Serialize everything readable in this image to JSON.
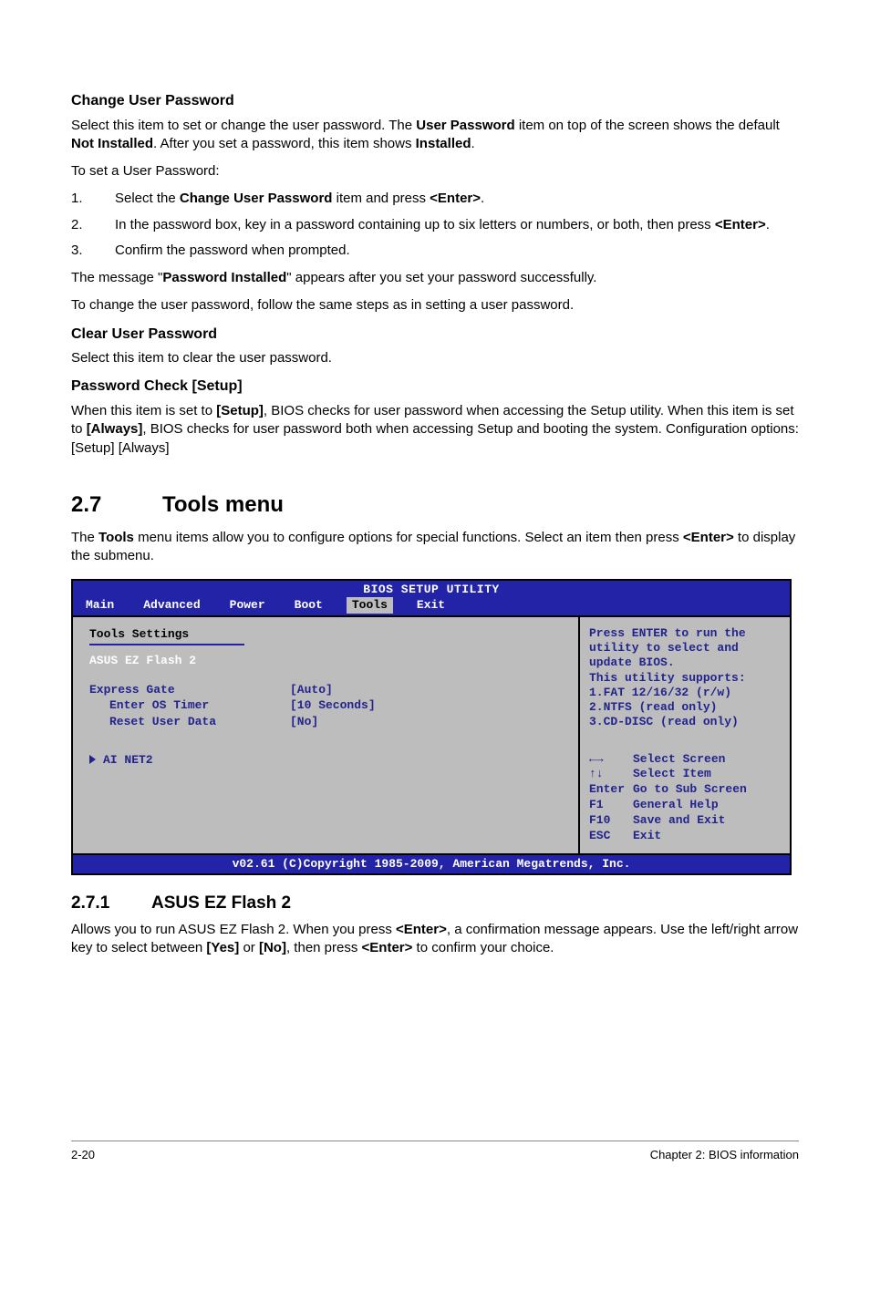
{
  "sec_change_user_pw": {
    "heading": "Change User Password",
    "p1_a": "Select this item to set or change the user password. The ",
    "p1_b": "User Password",
    "p1_c": " item on top of the screen shows the default ",
    "p1_d": "Not Installed",
    "p1_e": ". After you set a password, this item shows ",
    "p1_f": "Installed",
    "p1_g": ".",
    "p2": "To set a User Password:",
    "steps": [
      {
        "n": "1.",
        "t_a": "Select the ",
        "t_b": "Change User Password",
        "t_c": " item and press ",
        "t_d": "<Enter>",
        "t_e": "."
      },
      {
        "n": "2.",
        "t_a": "In the password box, key in a password containing up to six letters or numbers, or both, then press ",
        "t_b": "<Enter>",
        "t_c": "."
      },
      {
        "n": "3.",
        "t_a": "Confirm the password when prompted."
      }
    ],
    "p3_a": "The message \"",
    "p3_b": "Password Installed",
    "p3_c": "\" appears after you set your password successfully.",
    "p4": "To change the user password, follow the same steps as in setting a user password."
  },
  "sec_clear_user_pw": {
    "heading": "Clear User Password",
    "p1": "Select this item to clear the user password."
  },
  "sec_pw_check": {
    "heading": "Password Check [Setup]",
    "p1_a": "When this item is set to ",
    "p1_b": "[Setup]",
    "p1_c": ", BIOS checks for user password when accessing the Setup utility. When this item is set to ",
    "p1_d": "[Always]",
    "p1_e": ", BIOS checks for user password both when accessing Setup and booting the system. Configuration options: [Setup] [Always]"
  },
  "sec_tools": {
    "num": "2.7",
    "title": "Tools menu",
    "p1_a": "The ",
    "p1_b": "Tools",
    "p1_c": " menu items allow you to configure options for special functions. Select an item then press ",
    "p1_d": "<Enter>",
    "p1_e": " to display the submenu."
  },
  "bios": {
    "title": "BIOS SETUP UTILITY",
    "tabs": [
      "Main",
      "Advanced",
      "Power",
      "Boot",
      "Tools",
      "Exit"
    ],
    "tools_title": "Tools Settings",
    "item_ezflash": "ASUS EZ Flash 2",
    "rows": [
      {
        "label": "Express Gate",
        "val": "[Auto]"
      },
      {
        "label": "Enter OS Timer",
        "val": "[10 Seconds]"
      },
      {
        "label": "Reset User Data",
        "val": "[No]"
      }
    ],
    "item_ainet": "AI NET2",
    "help": "Press ENTER to run the utility to select and update BIOS.\nThis utility supports:\n1.FAT 12/16/32 (r/w)\n2.NTFS (read only)\n3.CD-DISC (read only)",
    "keys": [
      {
        "k": "←→",
        "d": "Select Screen"
      },
      {
        "k": "↑↓",
        "d": "Select Item"
      },
      {
        "k": "Enter",
        "d": "Go to Sub Screen"
      },
      {
        "k": "F1",
        "d": "General Help"
      },
      {
        "k": "F10",
        "d": "Save and Exit"
      },
      {
        "k": "ESC",
        "d": "Exit"
      }
    ],
    "footer": "v02.61 (C)Copyright 1985-2009, American Megatrends, Inc."
  },
  "sec_ezflash": {
    "num": "2.7.1",
    "title": "ASUS EZ Flash 2",
    "p1_a": "Allows you to run ASUS EZ Flash 2. When you press ",
    "p1_b": "<Enter>",
    "p1_c": ", a confirmation message appears. Use the left/right arrow key to select between ",
    "p1_d": "[Yes]",
    "p1_e": " or ",
    "p1_f": "[No]",
    "p1_g": ", then press ",
    "p1_h": "<Enter>",
    "p1_i": " to confirm your choice."
  },
  "footer": {
    "left": "2-20",
    "right": "Chapter 2: BIOS information"
  }
}
